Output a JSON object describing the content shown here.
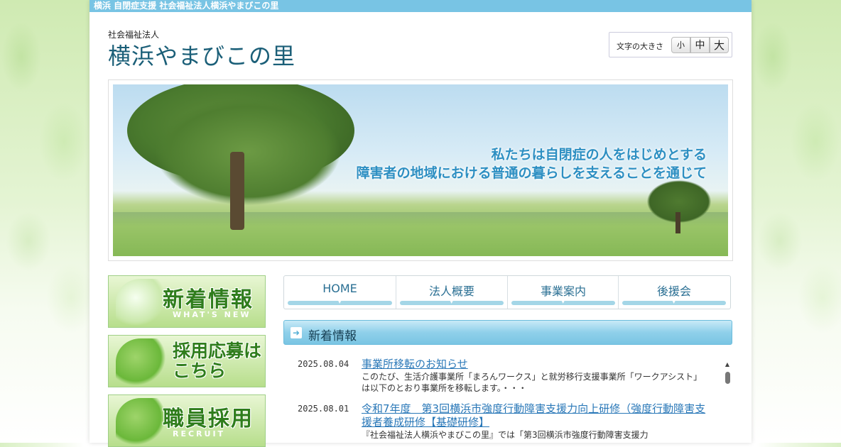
{
  "topbar": {
    "text": "横浜 自閉症支援 社会福祉法人横浜やまびこの里"
  },
  "header": {
    "org_type": "社会福祉法人",
    "site_name": "横浜やまびこの里",
    "fontsize": {
      "label": "文字の大きさ",
      "small": "小",
      "medium": "中",
      "large": "大"
    }
  },
  "hero": {
    "line1": "私たちは自閉症の人をはじめとする",
    "line2": "障害者の地域における普通の暮らしを支えることを通じて"
  },
  "sidebar": {
    "banners": [
      {
        "main": "新着情報",
        "sub": "WHAT'S NEW"
      },
      {
        "main_line1": "採用応募は",
        "main_line2": "こちら"
      },
      {
        "main": "職員採用",
        "sub": "RECRUIT"
      }
    ]
  },
  "nav": {
    "items": [
      {
        "label": "HOME"
      },
      {
        "label": "法人概要"
      },
      {
        "label": "事業案内"
      },
      {
        "label": "後援会"
      }
    ]
  },
  "news": {
    "heading": "新着情報",
    "items": [
      {
        "date": "2025.08.04",
        "title": "事業所移転のお知らせ",
        "body": "このたび、生活介護事業所「まろんワークス」と就労移行支援事業所「ワークアシスト」は以下のとおり事業所を移転します。・・・"
      },
      {
        "date": "2025.08.01",
        "title": "令和7年度　第3回横浜市強度行動障害支援力向上研修（強度行動障害支援者養成研修【基礎研修】",
        "body": "『社会福祉法人横浜やまびこの里』では「第3回横浜市強度行動障害支援力"
      }
    ]
  },
  "colors": {
    "topbar": "#78c4e4",
    "title": "#1b5f78",
    "link": "#2a78b8",
    "nav_text": "#2a6f93",
    "banner_green": "#2f7d1c"
  }
}
